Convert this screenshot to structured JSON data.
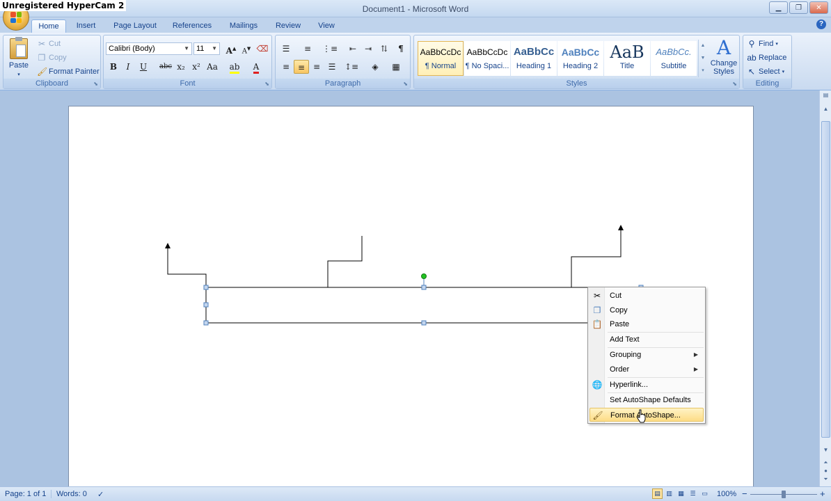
{
  "recorder_watermark": "Unregistered HyperCam 2",
  "window": {
    "title": "Document1 - Microsoft Word",
    "minimize_icon": "minimize-icon",
    "restore_icon": "restore-icon",
    "close_icon": "close-icon"
  },
  "tabs": [
    "Home",
    "Insert",
    "Page Layout",
    "References",
    "Mailings",
    "Review",
    "View"
  ],
  "help_label": "?",
  "clipboard": {
    "label": "Clipboard",
    "paste": "Paste",
    "cut": "Cut",
    "copy": "Copy",
    "format_painter": "Format Painter"
  },
  "font": {
    "label": "Font",
    "family": "Calibri (Body)",
    "size": "11",
    "bold": "B",
    "italic": "I",
    "underline": "U",
    "strike": "abc",
    "subscript": "x₂",
    "superscript": "x²",
    "change_case": "Aa",
    "grow": "A",
    "shrink": "A"
  },
  "paragraph": {
    "label": "Paragraph",
    "pilcrow": "¶"
  },
  "styles": {
    "label": "Styles",
    "items": [
      {
        "preview": "AaBbCcDc",
        "name": "¶ Normal"
      },
      {
        "preview": "AaBbCcDc",
        "name": "¶ No Spaci..."
      },
      {
        "preview": "AaBbCc",
        "name": "Heading 1"
      },
      {
        "preview": "AaBbCc",
        "name": "Heading 2"
      },
      {
        "preview": "AaB",
        "name": "Title"
      },
      {
        "preview": "AaBbCc.",
        "name": "Subtitle"
      }
    ],
    "change_styles_1": "Change",
    "change_styles_2": "Styles"
  },
  "editing": {
    "label": "Editing",
    "find": "Find",
    "replace": "Replace",
    "select": "Select"
  },
  "context_menu": {
    "items": [
      {
        "label": "Cut",
        "icon": "scissors-icon"
      },
      {
        "label": "Copy",
        "icon": "copy-icon"
      },
      {
        "label": "Paste",
        "icon": "paste-icon"
      },
      {
        "label": "Add Text",
        "icon": ""
      },
      {
        "label": "Grouping",
        "icon": "",
        "submenu": true
      },
      {
        "label": "Order",
        "icon": "",
        "submenu": true
      },
      {
        "label": "Hyperlink...",
        "icon": "hyperlink-icon"
      },
      {
        "label": "Set AutoShape Defaults",
        "icon": ""
      },
      {
        "label": "Format AutoShape...",
        "icon": "format-shape-icon",
        "highlighted": true
      }
    ]
  },
  "statusbar": {
    "page": "Page: 1 of 1",
    "words": "Words: 0",
    "zoom": "100%",
    "zoom_out": "−",
    "zoom_in": "+"
  },
  "colors": {
    "ribbon_text": "#15428b",
    "doc_background": "#abc3e1",
    "selection_handle": "#4f81bd",
    "rotate_handle": "#22c322",
    "menu_highlight": "#fddc86"
  }
}
